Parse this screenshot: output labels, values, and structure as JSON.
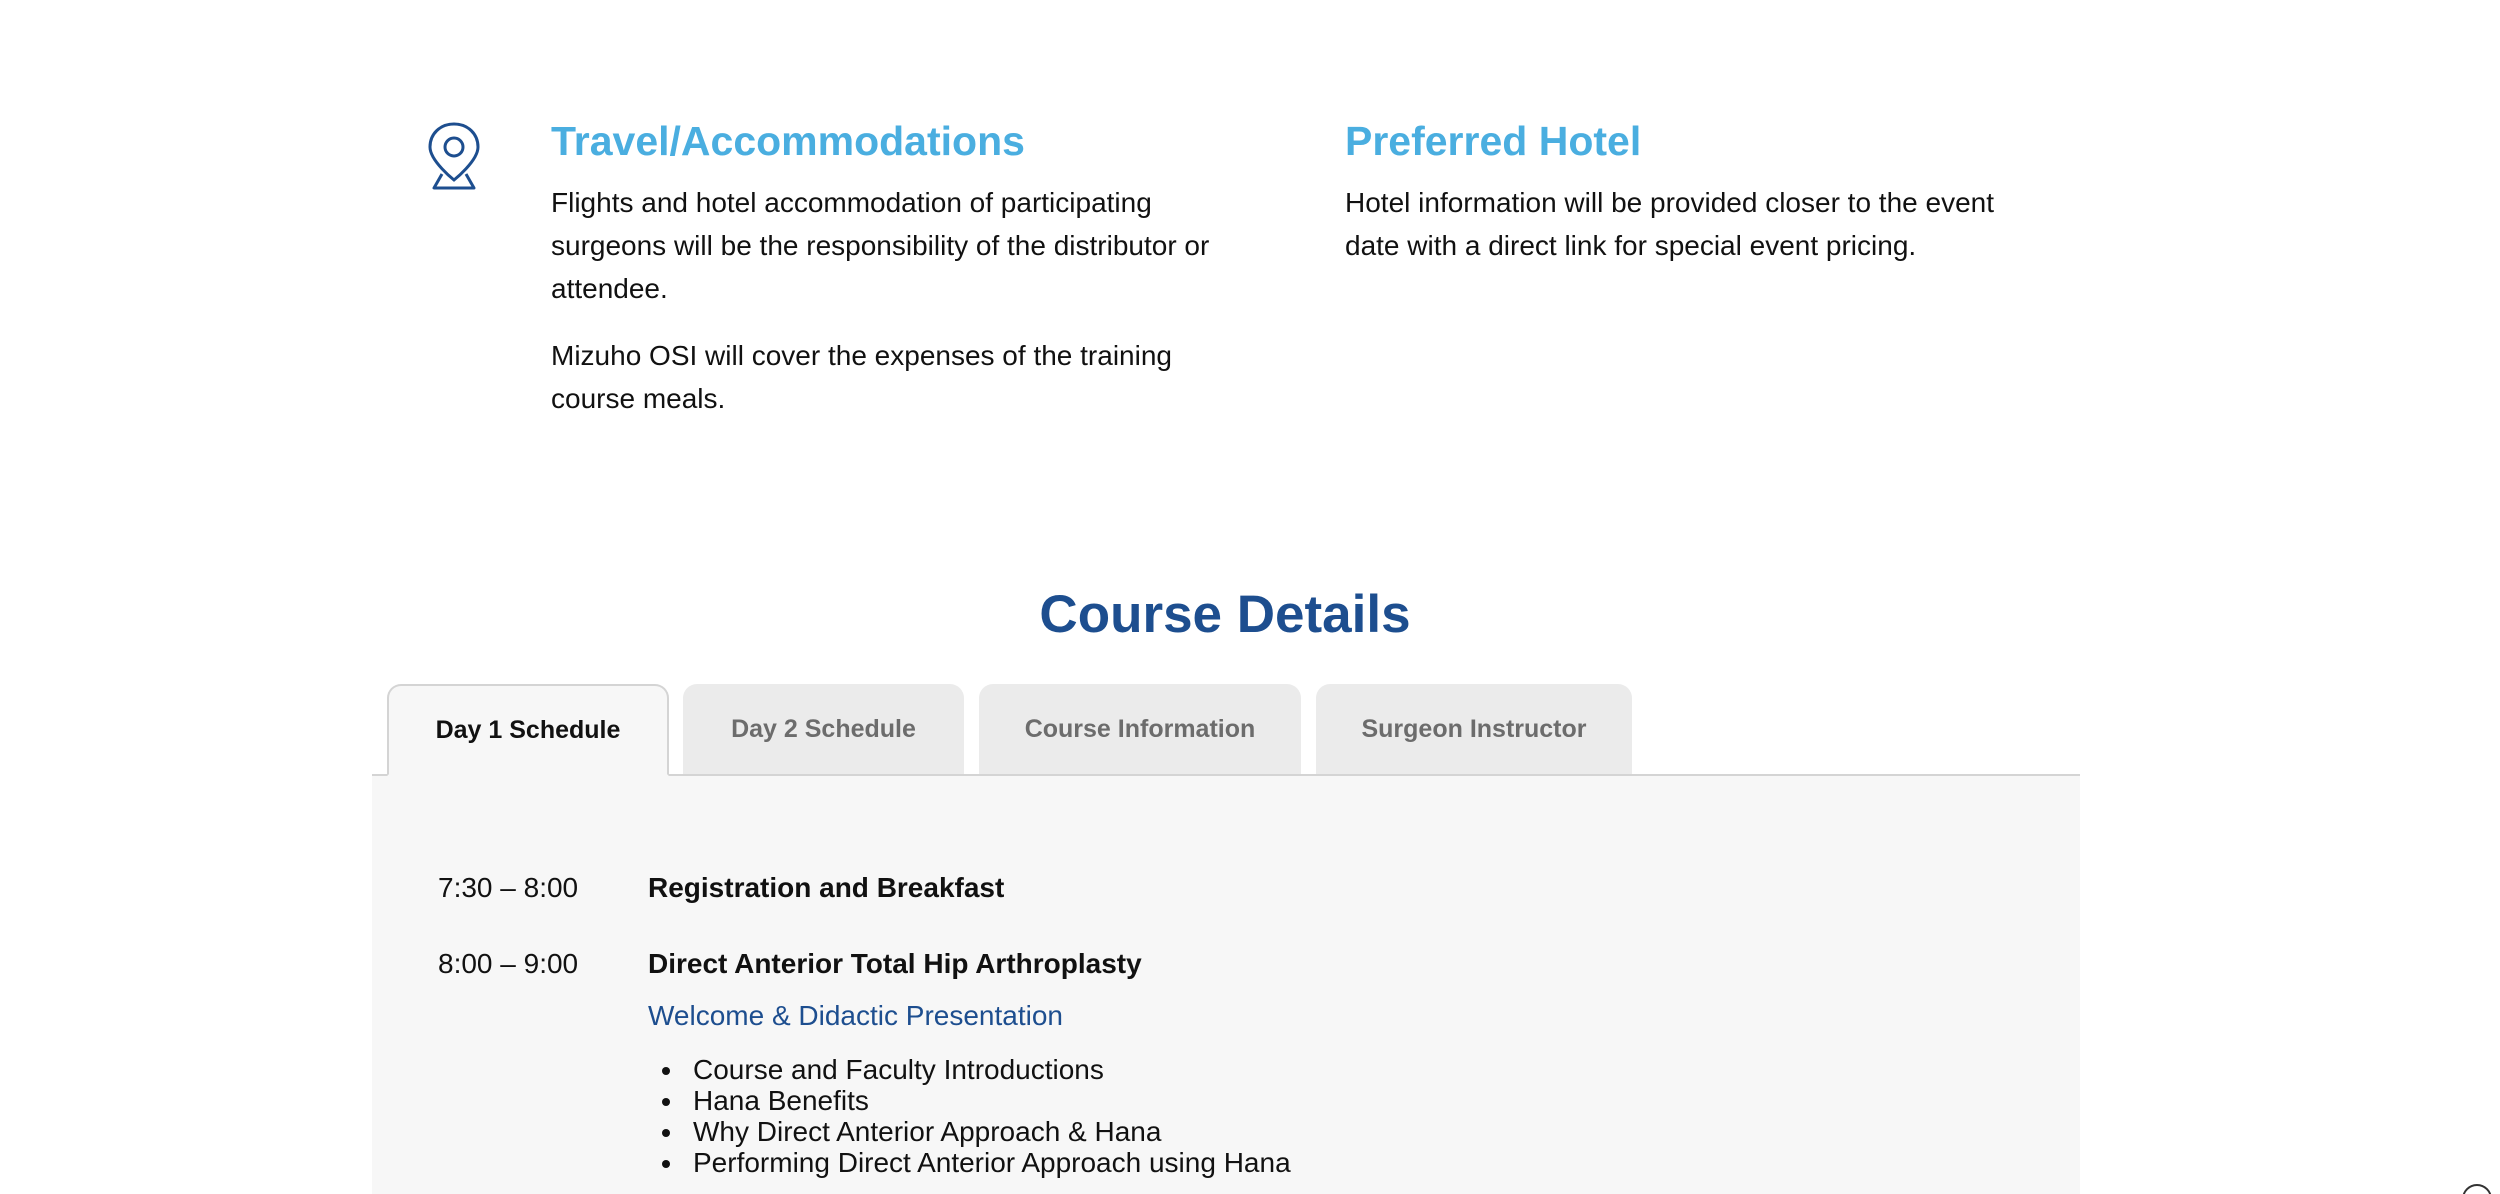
{
  "travel": {
    "icon": "map-pin-icon",
    "title": "Travel/Accommodations",
    "paragraph_1": "Flights and hotel accommodation of participating surgeons will be the responsibility of the distributor or attendee.",
    "paragraph_2": "Mizuho OSI will cover the expenses of the training course meals."
  },
  "hotel": {
    "title": "Preferred Hotel",
    "paragraph": "Hotel information will be provided closer to the event date with a direct link for special event pricing."
  },
  "course": {
    "title": "Course Details",
    "tabs": [
      {
        "label": "Day 1 Schedule",
        "active": true
      },
      {
        "label": "Day 2 Schedule",
        "active": false
      },
      {
        "label": "Course Information",
        "active": false
      },
      {
        "label": "Surgeon Instructor",
        "active": false
      }
    ],
    "schedule": [
      {
        "time": "7:30 – 8:00",
        "event": "Registration and Breakfast"
      },
      {
        "time": "8:00 – 9:00",
        "event": "Direct Anterior Total Hip Arthroplasty"
      }
    ],
    "subheading": "Welcome & Didactic Presentation",
    "bullets": [
      "Course and Faculty Introductions",
      "Hana Benefits",
      "Why Direct Anterior Approach & Hana",
      "Performing Direct Anterior Approach using Hana"
    ]
  },
  "colors": {
    "accent_light": "#4aaee0",
    "accent_dark": "#1d4e8f",
    "tab_inactive": "#ebebeb",
    "panel_background": "#f7f7f7"
  }
}
